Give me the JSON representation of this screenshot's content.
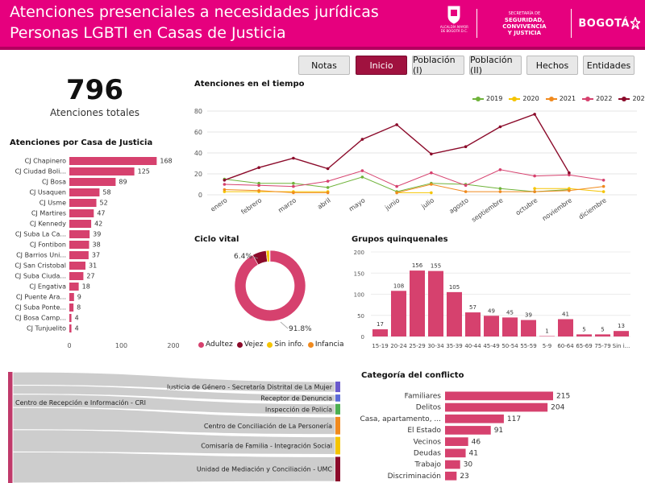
{
  "header": {
    "title_line1": "Atenciones presenciales a necesidades jurídicas",
    "title_line2": "Personas LGBTI en Casas de Justicia",
    "logo_alcaldia_text": "ALCALDÍA MAYOR DE BOGOTÁ D.C.",
    "logo_secretaria_line0": "SECRETARÍA DE",
    "logo_secretaria_line1": "SEGURIDAD, CONVIVENCIA",
    "logo_secretaria_line2": "Y JUSTICIA",
    "logo_bogota": "BOGOTÁ"
  },
  "nav": {
    "buttons": [
      {
        "label": "Notas",
        "active": false
      },
      {
        "label": "Inicio",
        "active": true
      },
      {
        "label": "Población (I)",
        "active": false
      },
      {
        "label": "Población (II)",
        "active": false
      },
      {
        "label": "Hechos",
        "active": false
      },
      {
        "label": "Entidades",
        "active": false
      }
    ]
  },
  "kpi": {
    "value": "796",
    "label": "Atenciones totales"
  },
  "titles": {
    "casas": "Atenciones por Casa de Justicia",
    "tiempo": "Atenciones en el tiempo",
    "ciclo": "Ciclo vital",
    "grupos": "Grupos quinquenales",
    "conflicto": "Categoría del conflicto"
  },
  "colors": {
    "pink": "#d6416e",
    "header": "#e6007e",
    "nav_active": "#a0123f",
    "y2019": "#6fb33a",
    "y2020": "#f5c400",
    "y2021": "#f08a1e",
    "y2022": "#d6416e",
    "y2023": "#8b0a2a",
    "adultez": "#d6416e",
    "vejez": "#8b0a2a",
    "sin_info": "#f5c400",
    "infancia": "#f08a1e"
  },
  "chart_data": [
    {
      "type": "bar",
      "orientation": "horizontal",
      "title": "Atenciones por Casa de Justicia",
      "categories": [
        "CJ Chapinero",
        "CJ Ciudad Boli...",
        "CJ Bosa",
        "CJ Usaquen",
        "CJ Usme",
        "CJ Martires",
        "CJ Kennedy",
        "CJ Suba La Ca...",
        "CJ Fontibon",
        "CJ Barrios Uni...",
        "CJ San Cristobal",
        "CJ Suba Ciuda...",
        "CJ Engativa",
        "CJ Puente Ara...",
        "CJ Suba Ponte...",
        "CJ Bosa Camp...",
        "CJ Tunjuelito"
      ],
      "values": [
        168,
        125,
        89,
        58,
        52,
        47,
        42,
        39,
        38,
        37,
        31,
        27,
        18,
        9,
        8,
        4,
        4
      ],
      "xticks": [
        "0",
        "100",
        "200"
      ],
      "xlim": [
        0,
        200
      ]
    },
    {
      "type": "line",
      "title": "Atenciones en el tiempo",
      "categories": [
        "enero",
        "febrero",
        "marzo",
        "abril",
        "mayo",
        "junio",
        "julio",
        "agosto",
        "septiembre",
        "octubre",
        "noviembre",
        "diciembre"
      ],
      "yticks": [
        "0",
        "20",
        "40",
        "60",
        "80"
      ],
      "ylim": [
        0,
        80
      ],
      "legend": "top-right",
      "series": [
        {
          "name": "2019",
          "values": [
            15,
            11,
            11,
            7,
            17,
            3,
            11,
            10,
            6,
            3,
            5,
            null
          ]
        },
        {
          "name": "2020",
          "values": [
            3,
            3,
            3,
            3,
            null,
            2,
            2,
            null,
            null,
            6,
            6,
            3
          ]
        },
        {
          "name": "2021",
          "values": [
            5,
            4,
            2,
            2,
            null,
            2,
            10,
            3,
            3,
            3,
            4,
            8
          ]
        },
        {
          "name": "2022",
          "values": [
            10,
            9,
            8,
            13,
            23,
            8,
            21,
            9,
            24,
            18,
            19,
            14
          ]
        },
        {
          "name": "2023",
          "values": [
            14,
            26,
            35,
            25,
            53,
            67,
            39,
            46,
            65,
            77,
            21,
            null
          ]
        }
      ]
    },
    {
      "type": "pie",
      "title": "Ciclo vital",
      "labels": [
        "Adultez",
        "Vejez",
        "Sin info.",
        "Infancia"
      ],
      "values": [
        91.8,
        6.4,
        1.5,
        0.3
      ],
      "data_labels": [
        "91.8%",
        "6.4%"
      ]
    },
    {
      "type": "bar",
      "title": "Grupos quinquenales",
      "categories": [
        "15-19",
        "20-24",
        "25-29",
        "30-34",
        "35-39",
        "40-44",
        "45-49",
        "50-54",
        "55-59",
        "5-9",
        "60-64",
        "65-69",
        "75-79",
        "Sin i..."
      ],
      "values": [
        17,
        108,
        156,
        155,
        105,
        57,
        49,
        45,
        39,
        1,
        41,
        5,
        5,
        13
      ],
      "yticks": [
        "0",
        "50",
        "100",
        "150",
        "200"
      ],
      "ylim": [
        0,
        200
      ]
    },
    {
      "type": "bar",
      "orientation": "horizontal",
      "title": "Categoría del conflicto",
      "categories": [
        "Familiares",
        "Delitos",
        "Casa, apartamento, ...",
        "El Estado",
        "Vecinos",
        "Deudas",
        "Trabajo",
        "Discriminación"
      ],
      "values": [
        215,
        204,
        117,
        91,
        46,
        41,
        30,
        23
      ],
      "xlim": [
        0,
        215
      ]
    }
  ],
  "sankey": {
    "source": "Centro de Recepción e Información - CRI",
    "targets": [
      {
        "label": "Justicia de Género - Secretaría Distrital de La Mujer",
        "color": "#6a5acd",
        "value": 3
      },
      {
        "label": "Receptor de Denuncia",
        "color": "#5b6bd8",
        "value": 2
      },
      {
        "label": "Inspección de Policía",
        "color": "#4caf50",
        "value": 3
      },
      {
        "label": "Centro de Conciliación de La Personería",
        "color": "#f08a1e",
        "value": 5
      },
      {
        "label": "Comisaría de Familia - Integración Social",
        "color": "#f5c400",
        "value": 5
      },
      {
        "label": "Unidad de Mediación y Conciliación - UMC",
        "color": "#8b0a2a",
        "value": 7
      }
    ]
  }
}
